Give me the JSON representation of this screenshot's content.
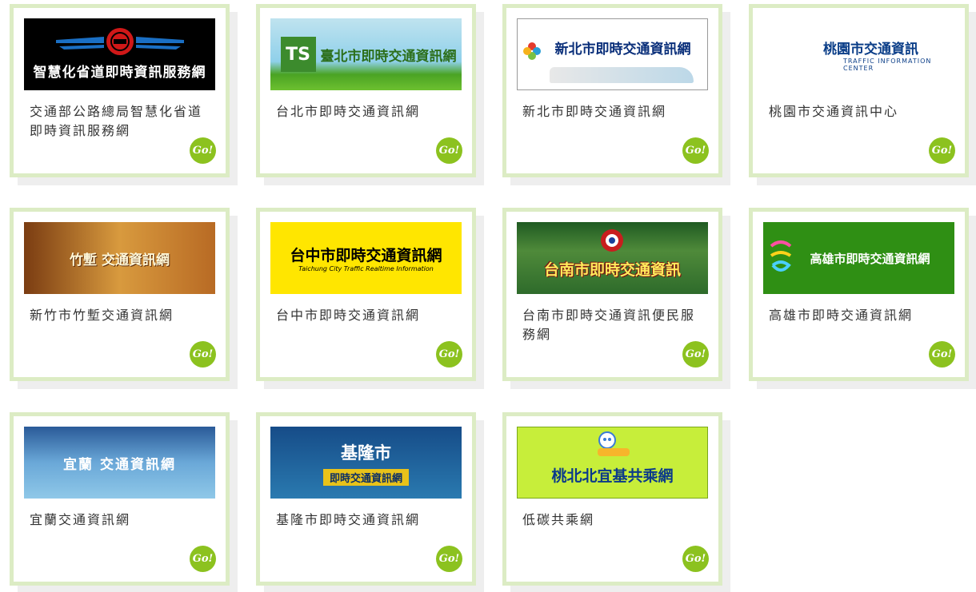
{
  "go_label": "Go!",
  "colors": {
    "card_border": "#dcecc4",
    "go_button": "#8cc21f"
  },
  "cards": [
    {
      "title": "交通部公路總局智慧化省道即時資訊服務網",
      "banner_text": "智慧化省道即時資訊服務網"
    },
    {
      "title": "台北市即時交通資訊網",
      "banner_text": "臺北市即時交通資訊網",
      "banner_logo": "TS"
    },
    {
      "title": "新北市即時交通資訊網",
      "banner_text": "新北市即時交通資訊網"
    },
    {
      "title": "桃園市交通資訊中心",
      "banner_text": "桃園市交通資訊",
      "banner_sub": "TRAFFIC INFORMATION CENTER"
    },
    {
      "title": "新竹市竹塹交通資訊網",
      "banner_text": "竹塹 交通資訊網"
    },
    {
      "title": "台中市即時交通資訊網",
      "banner_text": "台中市即時交通資訊網",
      "banner_sub": "Taichung City Traffic Realtime Information"
    },
    {
      "title": "台南市即時交通資訊便民服務網",
      "banner_text": "台南市即時交通資訊"
    },
    {
      "title": "高雄市即時交通資訊網",
      "banner_text": "高雄市即時交通資訊網"
    },
    {
      "title": "宜蘭交通資訊網",
      "banner_text": "宜蘭 交通資訊網"
    },
    {
      "title": "基隆市即時交通資訊網",
      "banner_text": "基隆市",
      "banner_sub": "即時交通資訊網"
    },
    {
      "title": "低碳共乘網",
      "banner_text": "桃北北宜基共乘網"
    }
  ]
}
